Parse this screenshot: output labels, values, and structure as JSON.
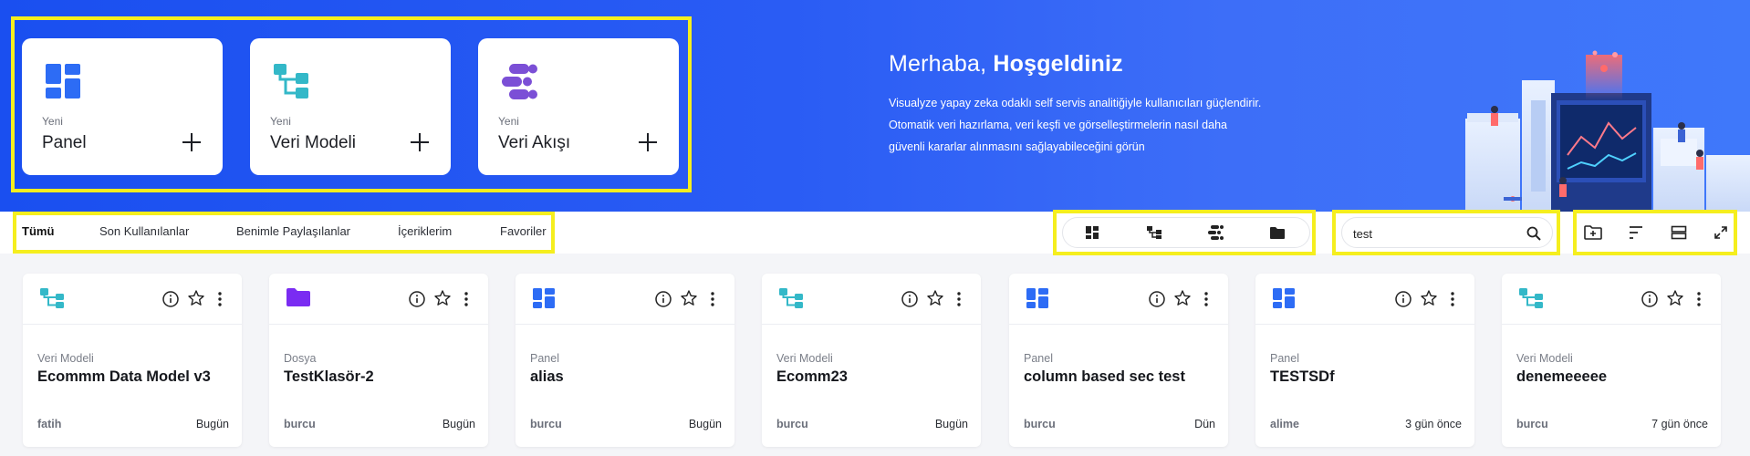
{
  "quick_actions": [
    {
      "small": "Yeni",
      "title": "Panel",
      "icon": "panel-grid-icon"
    },
    {
      "small": "Yeni",
      "title": "Veri Modeli",
      "icon": "data-model-icon"
    },
    {
      "small": "Yeni",
      "title": "Veri Akışı",
      "icon": "data-flow-icon"
    }
  ],
  "welcome": {
    "greeting": "Merhaba,",
    "name": "Hoşgeldiniz",
    "line1": "Visualyze yapay zeka odaklı self servis analitiğiyle kullanıcıları güçlendirir.",
    "line2": "Otomatik veri hazırlama, veri keşfi ve görselleştirmelerin nasıl daha",
    "line3": "güvenli kararlar alınmasını sağlayabileceğini görün"
  },
  "tabs": [
    "Tümü",
    "Son Kullanılanlar",
    "Benimle Paylaşılanlar",
    "İçeriklerim",
    "Favoriler"
  ],
  "active_tab": "Tümü",
  "type_filters": [
    "panel-grid-icon",
    "data-model-icon",
    "data-flow-icon",
    "folder-icon"
  ],
  "search": {
    "value": "test"
  },
  "actions": [
    "new-folder-icon",
    "sort-icon",
    "view-toggle-icon",
    "expand-icon"
  ],
  "cards": [
    {
      "type": "Veri Modeli",
      "title": "Ecommm Data Model v3",
      "owner": "fatih",
      "date": "Bugün",
      "icon": "data-model-icon"
    },
    {
      "type": "Dosya",
      "title": "TestKlasör-2",
      "owner": "burcu",
      "date": "Bugün",
      "icon": "folder-icon"
    },
    {
      "type": "Panel",
      "title": "alias",
      "owner": "burcu",
      "date": "Bugün",
      "icon": "panel-grid-icon"
    },
    {
      "type": "Veri Modeli",
      "title": "Ecomm23",
      "owner": "burcu",
      "date": "Bugün",
      "icon": "data-model-icon"
    },
    {
      "type": "Panel",
      "title": "column based sec test",
      "owner": "burcu",
      "date": "Dün",
      "icon": "panel-grid-icon"
    },
    {
      "type": "Panel",
      "title": "TESTSDf",
      "owner": "alime",
      "date": "3 gün önce",
      "icon": "panel-grid-icon"
    },
    {
      "type": "Veri Modeli",
      "title": "denemeeeee",
      "owner": "burcu",
      "date": "7 gün önce",
      "icon": "data-model-icon"
    }
  ],
  "colors": {
    "hero": "#2a5cf4",
    "panel": "#2d6cf5",
    "model": "#33b8c8",
    "flow": "#7b4fd6",
    "folder": "#7a2cf2",
    "highlight": "#f5ee1e"
  }
}
